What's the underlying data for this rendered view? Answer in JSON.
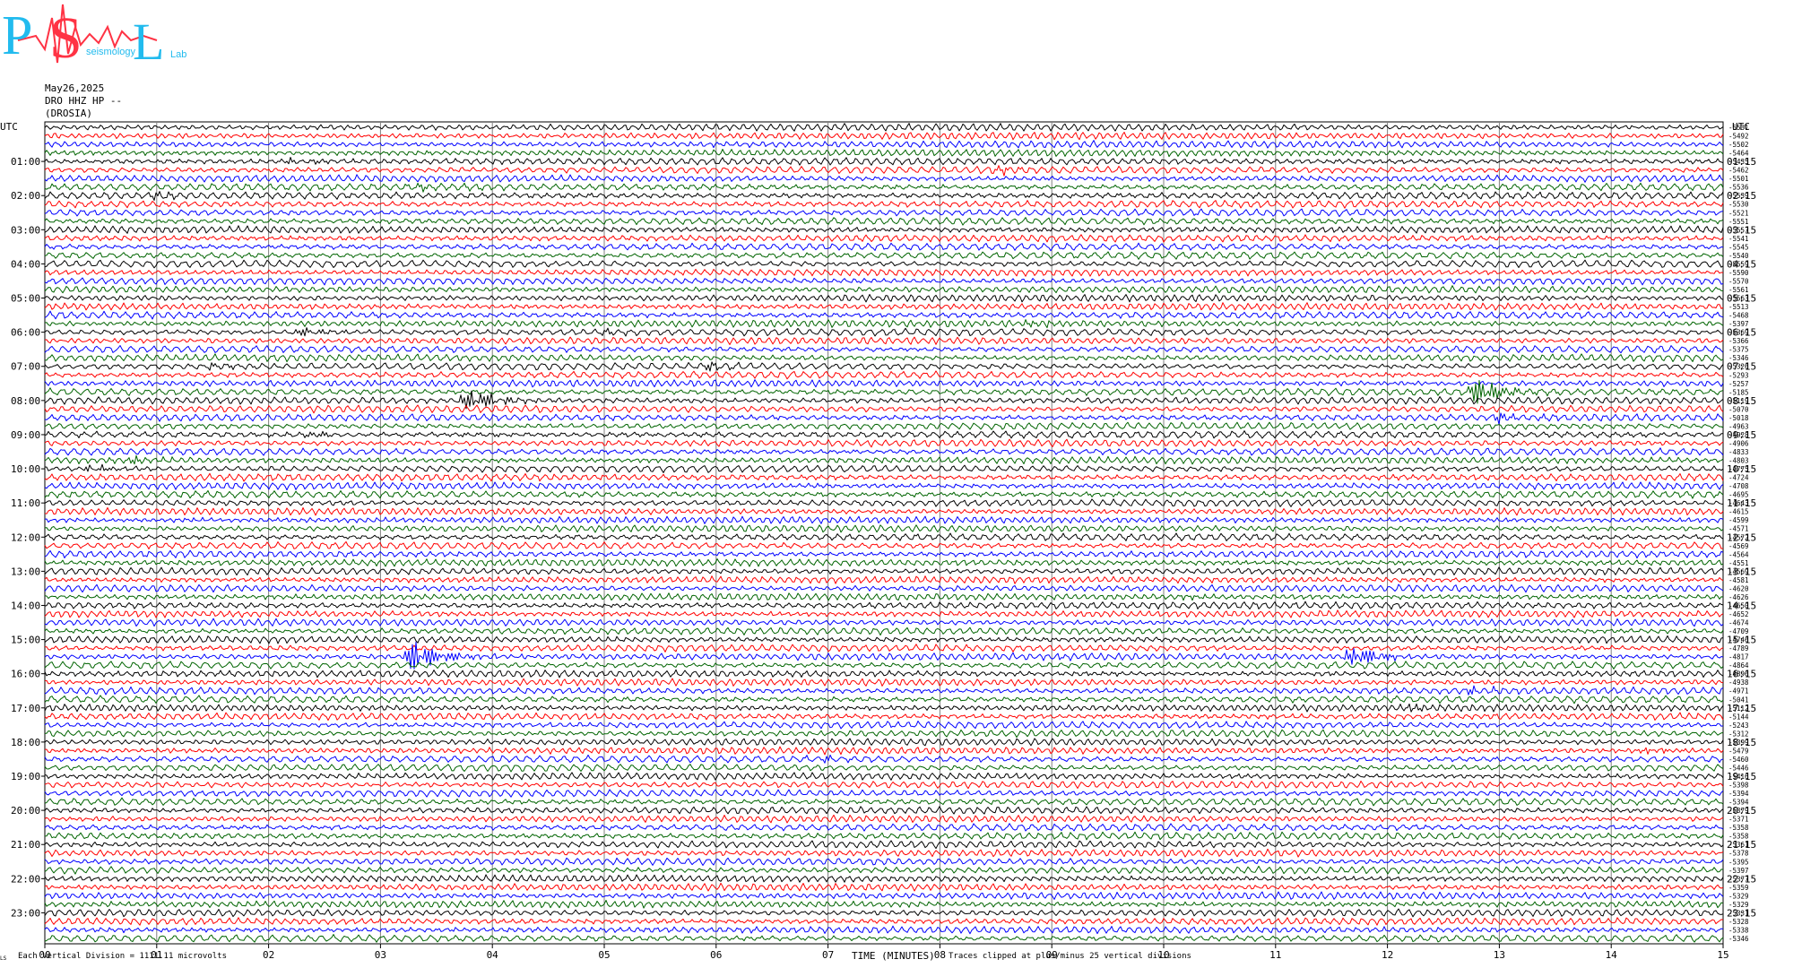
{
  "logo": {
    "letter_p": "P",
    "letter_s": "S",
    "letter_l": "L",
    "small_text": "seismology",
    "small_text_2": "Lab",
    "red": "#ff3344",
    "cyan": "#22bbee"
  },
  "header": {
    "date": "May26,2025",
    "station": "DRO HHZ HP --",
    "location": "(DROSIA)"
  },
  "footer": {
    "scale_note": "Each Vertical Division = 1111.11 microvolts",
    "x_axis_title": "TIME (MINUTES)",
    "clip_note": "Traces clipped at plus/minus 25 vertical divisions",
    "corner_mark": "LS"
  },
  "chart_data": {
    "type": "line",
    "title": "",
    "xlabel": "TIME (MINUTES)",
    "ylabel": "UTC",
    "x_ticks": [
      "00",
      "01",
      "02",
      "03",
      "04",
      "05",
      "06",
      "07",
      "08",
      "09",
      "10",
      "11",
      "12",
      "13",
      "14",
      "15"
    ],
    "xlim": [
      0,
      15
    ],
    "left_axis_label": "UTC",
    "right_axis_label": "UTC",
    "left_hour_labels": [
      "01:00",
      "02:00",
      "03:00",
      "04:00",
      "05:00",
      "06:00",
      "07:00",
      "08:00",
      "09:00",
      "10:00",
      "11:00",
      "12:00",
      "13:00",
      "14:00",
      "15:00",
      "16:00",
      "17:00",
      "18:00",
      "19:00",
      "20:00",
      "21:00",
      "22:00",
      "23:00"
    ],
    "right_hour_labels": [
      "01:15",
      "02:15",
      "03:15",
      "04:15",
      "05:15",
      "06:15",
      "07:15",
      "08:15",
      "09:15",
      "10:15",
      "11:15",
      "12:15",
      "13:15",
      "14:15",
      "15:15",
      "16:15",
      "17:15",
      "18:15",
      "19:15",
      "20:15",
      "21:15",
      "22:15",
      "23:15"
    ],
    "rows_per_hour": 4,
    "minutes_per_row": 15,
    "trace_colors": [
      "#000000",
      "#ff0000",
      "#0000ff",
      "#006400"
    ],
    "grid": true,
    "row_offsets": [
      "-5531",
      "-5492",
      "-5502",
      "-5464",
      "-5435",
      "-5462",
      "-5501",
      "-5536",
      "-5539",
      "-5530",
      "-5521",
      "-5551",
      "-5557",
      "-5541",
      "-5545",
      "-5540",
      "-5559",
      "-5590",
      "-5570",
      "-5561",
      "-5563",
      "-5513",
      "-5468",
      "-5397",
      "-5369",
      "-5366",
      "-5375",
      "-5346",
      "-5326",
      "-5293",
      "-5257",
      "-5185",
      "-5119",
      "-5070",
      "-5018",
      "-4963",
      "-4928",
      "-4906",
      "-4833",
      "-4803",
      "-4775",
      "-4724",
      "-4708",
      "-4695",
      "-4643",
      "-4615",
      "-4599",
      "-4571",
      "-4572",
      "-4569",
      "-4564",
      "-4551",
      "-4569",
      "-4581",
      "-4620",
      "-4626",
      "-4650",
      "-4652",
      "-4674",
      "-4709",
      "-4746",
      "-4789",
      "-4817",
      "-4864",
      "-4896",
      "-4938",
      "-4971",
      "-5041",
      "-5112",
      "-5144",
      "-5243",
      "-5312",
      "-5399",
      "-5479",
      "-5460",
      "-5446",
      "-5416",
      "-5398",
      "-5394",
      "-5394",
      "-5379",
      "-5371",
      "-5358",
      "-5358",
      "-5361",
      "-5378",
      "-5395",
      "-5397",
      "-5377",
      "-5359",
      "-5329",
      "-5329",
      "-5331",
      "-5328",
      "-5338",
      "-5346"
    ],
    "events": [
      {
        "row": 4,
        "minute": 2.2,
        "amplitude": 3
      },
      {
        "row": 5,
        "minute": 8.5,
        "amplitude": 4
      },
      {
        "row": 7,
        "minute": 3.4,
        "amplitude": 4
      },
      {
        "row": 8,
        "minute": 1.0,
        "amplitude": 3
      },
      {
        "row": 23,
        "minute": 8.8,
        "amplitude": 3
      },
      {
        "row": 24,
        "minute": 2.3,
        "amplitude": 5
      },
      {
        "row": 24,
        "minute": 5.0,
        "amplitude": 3
      },
      {
        "row": 28,
        "minute": 1.5,
        "amplitude": 4
      },
      {
        "row": 28,
        "minute": 5.9,
        "amplitude": 5
      },
      {
        "row": 31,
        "minute": 12.8,
        "amplitude": 18
      },
      {
        "row": 32,
        "minute": 3.8,
        "amplitude": 16
      },
      {
        "row": 34,
        "minute": 13.0,
        "amplitude": 5
      },
      {
        "row": 36,
        "minute": 2.4,
        "amplitude": 4
      },
      {
        "row": 39,
        "minute": 0.7,
        "amplitude": 5
      },
      {
        "row": 40,
        "minute": 0.4,
        "amplitude": 4
      },
      {
        "row": 55,
        "minute": 10.2,
        "amplitude": 3
      },
      {
        "row": 62,
        "minute": 3.3,
        "amplitude": 22
      },
      {
        "row": 62,
        "minute": 9.0,
        "amplitude": 3
      },
      {
        "row": 62,
        "minute": 11.7,
        "amplitude": 14
      },
      {
        "row": 66,
        "minute": 12.7,
        "amplitude": 4
      },
      {
        "row": 68,
        "minute": 12.2,
        "amplitude": 4
      },
      {
        "row": 73,
        "minute": 14.3,
        "amplitude": 4
      },
      {
        "row": 74,
        "minute": 6.9,
        "amplitude": 4
      }
    ]
  }
}
